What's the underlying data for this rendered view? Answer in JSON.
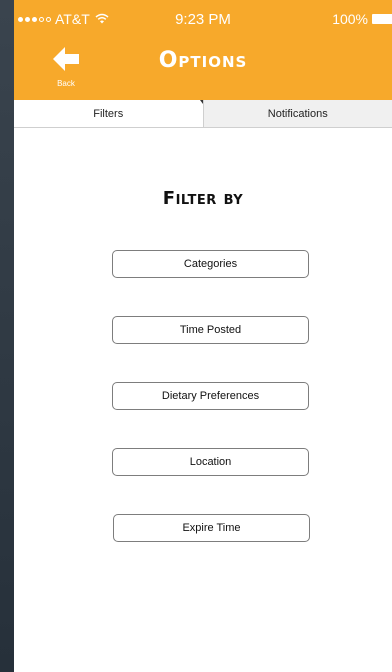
{
  "status_bar": {
    "carrier": "AT&T",
    "time": "9:23 PM",
    "battery": "100%"
  },
  "header": {
    "title": "Options",
    "back_label": "Back",
    "background": "#f7a92b"
  },
  "tabs": [
    {
      "label": "Filters",
      "active": true
    },
    {
      "label": "Notifications",
      "active": false
    }
  ],
  "filters": {
    "heading": "Filter by",
    "buttons": [
      {
        "label": "Categories"
      },
      {
        "label": "Time Posted"
      },
      {
        "label": "Dietary Preferences"
      },
      {
        "label": "Location"
      },
      {
        "label": "Expire Time"
      }
    ]
  }
}
